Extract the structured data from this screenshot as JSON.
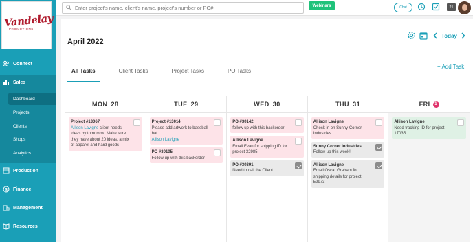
{
  "brand": {
    "name": "Vandelay",
    "tagline": "PROMOTIONS"
  },
  "sidebar": {
    "items": [
      {
        "label": "Connect",
        "icon": "people-icon"
      },
      {
        "label": "Sales",
        "icon": "bar-chart-icon"
      },
      {
        "label": "Production",
        "icon": "production-icon"
      },
      {
        "label": "Finance",
        "icon": "dollar-icon"
      },
      {
        "label": "Management",
        "icon": "building-icon"
      },
      {
        "label": "Resources",
        "icon": "book-icon"
      }
    ],
    "sales_sub": [
      "Dashboard",
      "Projects",
      "Clients",
      "Shops",
      "Analytics"
    ]
  },
  "topbar": {
    "search_placeholder": "Enter project's name, client's name, project's number or PO#",
    "webinars": "Webinars",
    "chat": "Chat",
    "badge": "21"
  },
  "calendar": {
    "month": "April 2022",
    "today_label": "Today",
    "tabs": [
      "All Tasks",
      "Client Tasks",
      "Project Tasks",
      "PO Tasks"
    ],
    "add_task": "+ Add Task",
    "days": [
      {
        "name": "MON",
        "num": "28",
        "cards": [
          {
            "color": "pink",
            "title": "Project #13067",
            "link": "Allison Lavigne",
            "body": " client needs ideas by tomorrow. Make sure they have about 20 ideas, a mix of apparel and hard goods",
            "checked": false
          }
        ]
      },
      {
        "name": "TUE",
        "num": "29",
        "cards": [
          {
            "color": "pink",
            "title": "Project #13014",
            "body": "Please add artwork to baseball hat",
            "link2": "Allison Lavigne",
            "checked": false
          },
          {
            "color": "pink",
            "title": "PO #30105",
            "body": "Follow up with this backorder",
            "checked": false
          }
        ]
      },
      {
        "name": "WED",
        "num": "30",
        "cards": [
          {
            "color": "pink",
            "title": "PO #30142",
            "body": "follow up with this backorder",
            "checked": false
          },
          {
            "color": "pink",
            "title": "Allison Lavigne",
            "body": "Email Evan for shipping ID for project 32985",
            "checked": false
          },
          {
            "color": "grey",
            "title": "PO #30391",
            "body": "Need to call the Client",
            "checked": true
          }
        ]
      },
      {
        "name": "THU",
        "num": "31",
        "cards": [
          {
            "color": "pink",
            "title": "Allison Lavigne",
            "body": "Check in on Sunny Corner Industries",
            "checked": false
          },
          {
            "color": "grey",
            "title": "Sunny Corner Industries",
            "body": "Follow up this week!",
            "checked": true
          },
          {
            "color": "grey",
            "title": "Allison Lavigne",
            "body": "Email Oscar Graham for shipping details for project 59973",
            "checked": true
          }
        ]
      },
      {
        "name": "FRI",
        "num": "1",
        "cards": [
          {
            "color": "green",
            "title": "Allison Lavigne",
            "body": "Need tracking ID for project 17035",
            "checked": false
          }
        ]
      }
    ]
  }
}
